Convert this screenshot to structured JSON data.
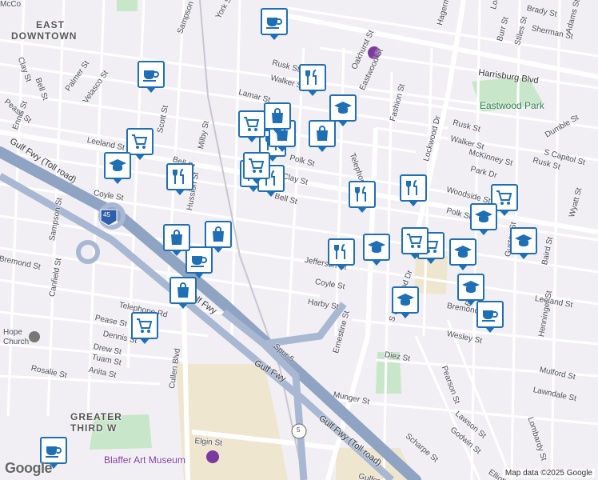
{
  "map": {
    "attribution": "Map data ©2025 Google",
    "logo": "Google",
    "areas": [
      {
        "id": "east-downtown-1",
        "text": "EAST"
      },
      {
        "id": "east-downtown-2",
        "text": "DOWNTOWN"
      },
      {
        "id": "greater-third-1",
        "text": "GREATER"
      },
      {
        "id": "greater-third-2",
        "text": "THIRD W"
      }
    ],
    "places": [
      {
        "id": "eastwood-park",
        "text": "Eastwood Park"
      },
      {
        "id": "blaffer",
        "text": "Blaffer Art Museum"
      },
      {
        "id": "hope-church-1",
        "text": "Hope"
      },
      {
        "id": "hope-church-2",
        "text": "Church"
      }
    ],
    "highways": [
      {
        "id": "gulf-fwy-toll-1",
        "text": "Gulf Fwy (Toll road)"
      },
      {
        "id": "gulf-fwy-toll-2",
        "text": "Gulf Fwy (Toll road)"
      },
      {
        "id": "gulf-fwy-1",
        "text": "Gulf Fwy"
      },
      {
        "id": "gulf-fwy-2",
        "text": "Gulf Fwy"
      },
      {
        "id": "spur-5",
        "text": "Spur 5"
      },
      {
        "id": "i45",
        "text": "45"
      },
      {
        "id": "hwy5",
        "text": "5"
      },
      {
        "id": "harrisburg-blvd",
        "text": "Harrisburg Blvd"
      }
    ],
    "streets": [
      "Sampson St",
      "York St",
      "Clay St",
      "Bell St",
      "Palmer St",
      "Velasco St",
      "Pease St",
      "Ennis St",
      "Leeland St",
      "Scott St",
      "Bell St",
      "Milby St",
      "Coyle St",
      "Hussion St",
      "Bremond St",
      "Sampson St",
      "Canfield St",
      "Rosalie St",
      "Dennis St",
      "Drew St",
      "Tuam St",
      "Anita St",
      "Cullen Blvd",
      "Elgin St",
      "Rusk St",
      "Walker St",
      "Lamar St",
      "Oakhurst St",
      "Eastwood St",
      "Fashion St",
      "Telephone Rd",
      "Polk St",
      "Clay St",
      "Bell St",
      "Jefferson St",
      "Coyle St",
      "Harby St",
      "Ernestine St",
      "S Lockwood Dr",
      "Lockwood Dr",
      "Hagerman St",
      "Lockwood Dr",
      "Brady St",
      "Sherman St",
      "Burr St",
      "Stiles St",
      "Adams St",
      "Rusk St",
      "Walker St",
      "McKinney St",
      "Park Dr",
      "Dumble St",
      "S Capitol St",
      "Rusk St",
      "Woodside St",
      "Polk St",
      "Wyatt St",
      "Gustav St",
      "Baird St",
      "Leeland St",
      "Elliott St",
      "Wesley St",
      "Henninger St",
      "Mulford St",
      "Lawndale St",
      "Diez St",
      "Munger St",
      "Pearson St",
      "Lawson St",
      "Godwin St",
      "Scharpe St",
      "Gulfcrest St",
      "Elliott St",
      "Lombardy St",
      "Telephone Rd",
      "Bremond St",
      "Pease St",
      "McCo"
    ],
    "markers": [
      {
        "id": "m1",
        "icon": "cafe"
      },
      {
        "id": "m2",
        "icon": "cafe"
      },
      {
        "id": "m3",
        "icon": "cafe"
      },
      {
        "id": "m4",
        "icon": "cafe"
      },
      {
        "id": "m5",
        "icon": "cafe"
      },
      {
        "id": "m6",
        "icon": "restaurant"
      },
      {
        "id": "m7",
        "icon": "restaurant"
      },
      {
        "id": "m8",
        "icon": "restaurant"
      },
      {
        "id": "m9",
        "icon": "restaurant"
      },
      {
        "id": "m10",
        "icon": "restaurant"
      },
      {
        "id": "m11",
        "icon": "restaurant"
      },
      {
        "id": "m12",
        "icon": "restaurant"
      },
      {
        "id": "m13",
        "icon": "restaurant"
      },
      {
        "id": "m14",
        "icon": "shopping-bag"
      },
      {
        "id": "m15",
        "icon": "shopping-bag"
      },
      {
        "id": "m16",
        "icon": "shopping-bag"
      },
      {
        "id": "m17",
        "icon": "shopping-bag"
      },
      {
        "id": "m18",
        "icon": "shopping-bag"
      },
      {
        "id": "m19",
        "icon": "shopping-bag"
      },
      {
        "id": "m20",
        "icon": "shopping-cart"
      },
      {
        "id": "m21",
        "icon": "shopping-cart"
      },
      {
        "id": "m22",
        "icon": "shopping-cart"
      },
      {
        "id": "m23",
        "icon": "shopping-cart"
      },
      {
        "id": "m24",
        "icon": "shopping-cart"
      },
      {
        "id": "m25",
        "icon": "shopping-cart"
      },
      {
        "id": "m26",
        "icon": "shopping-cart"
      },
      {
        "id": "m27",
        "icon": "school"
      },
      {
        "id": "m28",
        "icon": "school"
      },
      {
        "id": "m29",
        "icon": "school"
      },
      {
        "id": "m30",
        "icon": "school"
      },
      {
        "id": "m31",
        "icon": "school"
      },
      {
        "id": "m32",
        "icon": "school"
      },
      {
        "id": "m33",
        "icon": "school"
      },
      {
        "id": "m34",
        "icon": "school"
      }
    ],
    "colors": {
      "marker": "#1f6fb5",
      "park": "#c8e6c9",
      "campus": "#efe6cf",
      "highway": "#8fa3c2",
      "water": "#aadaff"
    }
  }
}
